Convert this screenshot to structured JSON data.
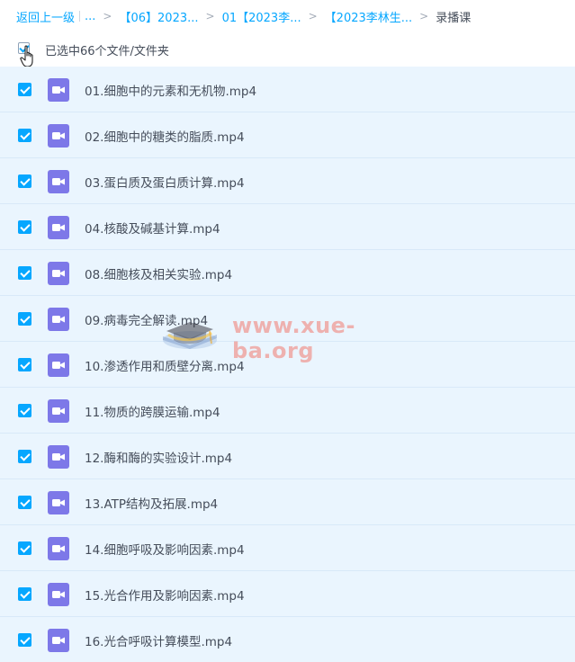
{
  "breadcrumb": {
    "back": "返回上一级",
    "ellipsis": "...",
    "items": [
      "【06】2023...",
      "01【2023李...",
      "【2023李林生...",
      "录播课"
    ]
  },
  "selection": {
    "label": "已选中66个文件/文件夹"
  },
  "files": [
    "01.细胞中的元素和无机物.mp4",
    "02.细胞中的糖类的脂质.mp4",
    "03.蛋白质及蛋白质计算.mp4",
    "04.核酸及碱基计算.mp4",
    "08.细胞核及相关实验.mp4",
    "09.病毒完全解读.mp4",
    "10.渗透作用和质壁分离.mp4",
    "11.物质的跨膜运输.mp4",
    "12.酶和酶的实验设计.mp4",
    "13.ATP结构及拓展.mp4",
    "14.细胞呼吸及影响因素.mp4",
    "15.光合作用及影响因素.mp4",
    "16.光合呼吸计算模型.mp4"
  ],
  "watermark": {
    "text": "www.xue-ba.org"
  },
  "colors": {
    "accent": "#06a7ff",
    "row_bg": "#eaf5fe",
    "video_icon": "#7d78e8",
    "text": "#454d5a"
  },
  "icons": {
    "file": "video-file-icon",
    "checkbox": "checkbox-checked-icon",
    "cursor": "hand-cursor-icon"
  }
}
